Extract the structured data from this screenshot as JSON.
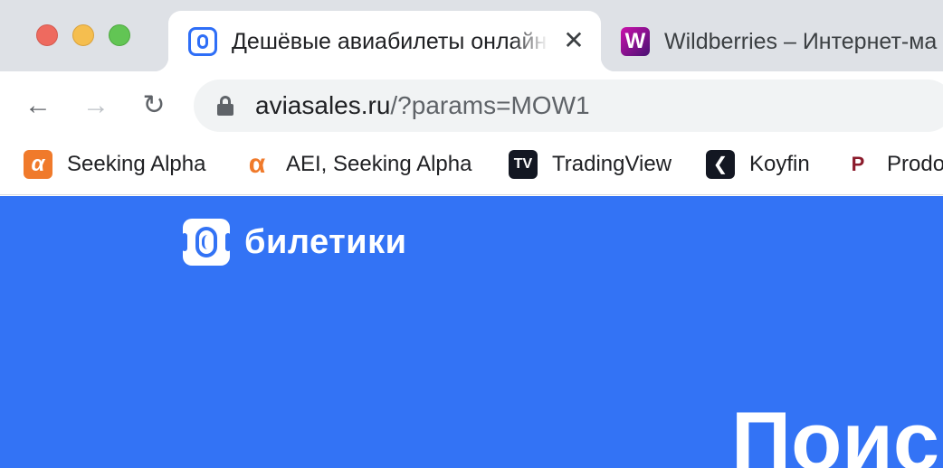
{
  "window": {
    "controls": [
      "close",
      "minimize",
      "maximize"
    ]
  },
  "tabs": [
    {
      "title": "Дешёвые авиабилеты онлайн",
      "icon": "aviasales-favicon",
      "active": true
    },
    {
      "title": "Wildberries – Интернет-ма",
      "icon": "wildberries-favicon",
      "favicon_letter": "W",
      "active": false
    }
  ],
  "toolbar": {
    "back": "←",
    "forward": "→",
    "reload": "↻",
    "url_host": "aviasales.ru",
    "url_path": "/?params=MOW1"
  },
  "bookmarks": [
    {
      "label": "Seeking Alpha",
      "glyph": "α",
      "icon": "seeking-alpha-icon"
    },
    {
      "label": "AEI, Seeking Alpha",
      "glyph": "α",
      "icon": "seeking-alpha-icon"
    },
    {
      "label": "TradingView",
      "glyph": "TV",
      "icon": "tradingview-icon"
    },
    {
      "label": "Koyfin",
      "glyph": "❮",
      "icon": "koyfin-icon"
    },
    {
      "label": "Prodo",
      "glyph": "P",
      "icon": "prodo-icon"
    }
  ],
  "page": {
    "logo_text": "билетики",
    "headline": "Поис",
    "background": "#3373f5"
  },
  "colors": {
    "accent": "#2e6ef7",
    "tabstrip": "#dee1e6"
  }
}
